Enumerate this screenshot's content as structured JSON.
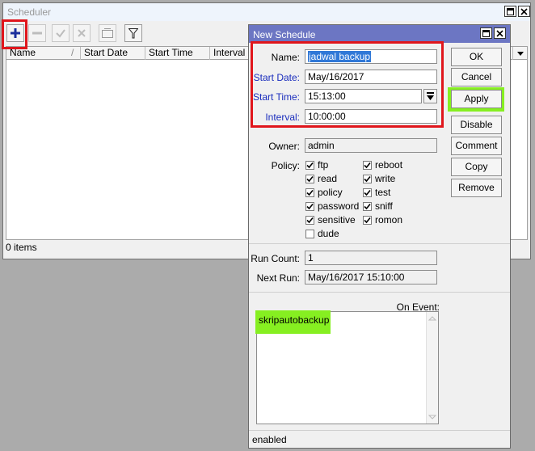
{
  "scheduler": {
    "title": "Scheduler",
    "columns": [
      "Name",
      "Start Date",
      "Start Time",
      "Interval"
    ],
    "status": "0 items"
  },
  "dialog": {
    "title": "New Schedule",
    "name_label": "Name:",
    "name_value": "jadwal backup",
    "start_date_label": "Start Date:",
    "start_date_value": "May/16/2017",
    "start_time_label": "Start Time:",
    "start_time_value": "15:13:00",
    "interval_label": "Interval:",
    "interval_value": "10:00:00",
    "owner_label": "Owner:",
    "owner_value": "admin",
    "policy_label": "Policy:",
    "policies_left": [
      "ftp",
      "read",
      "policy",
      "password",
      "sensitive",
      "dude"
    ],
    "policies_right": [
      "reboot",
      "write",
      "test",
      "sniff",
      "romon"
    ],
    "run_count_label": "Run Count:",
    "run_count_value": "1",
    "next_run_label": "Next Run:",
    "next_run_value": "May/16/2017 15:10:00",
    "on_event_label": "On Event:",
    "on_event_value": "skripautobackup",
    "buttons": {
      "ok": "OK",
      "cancel": "Cancel",
      "apply": "Apply",
      "disable": "Disable",
      "comment": "Comment",
      "copy": "Copy",
      "remove": "Remove"
    },
    "status": "enabled"
  },
  "colors": {
    "dialog_title_bg": "#6c76c3",
    "highlight_red": "#e0161c",
    "highlight_green": "#86ef21",
    "blue_label": "#1a2dbd"
  }
}
